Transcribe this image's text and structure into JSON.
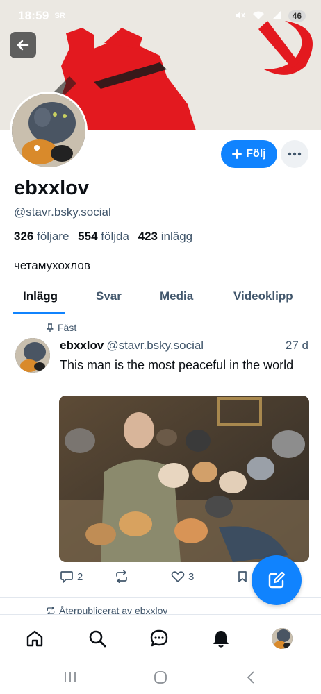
{
  "status_bar": {
    "time": "18:59",
    "notification_icon": "SR",
    "battery": "46",
    "icons": [
      "mute-icon",
      "wifi-icon",
      "signal-icon"
    ]
  },
  "header": {
    "back_icon": "arrow-left-icon"
  },
  "profile": {
    "display_name": "ebxxlov",
    "handle": "@stavr.bsky.social",
    "follow_label": "Följ",
    "more_icon": "ellipsis-icon",
    "stats": {
      "followers_count": "326",
      "followers_label": "följare",
      "following_count": "554",
      "following_label": "följda",
      "posts_count": "423",
      "posts_label": "inlägg"
    },
    "bio": "четамухохлов"
  },
  "tabs": [
    {
      "label": "Inlägg",
      "active": true
    },
    {
      "label": "Svar",
      "active": false
    },
    {
      "label": "Media",
      "active": false
    },
    {
      "label": "Videoklipp",
      "active": false
    }
  ],
  "post": {
    "pinned_label": "Fäst",
    "author": "ebxxlov",
    "handle": "@stavr.bsky.social",
    "time": "27 d",
    "text": "This man is the most peaceful in the world",
    "replies": "2",
    "likes": "3"
  },
  "next_post": {
    "repost_label": "Återpublicerat av ebxxlov"
  },
  "colors": {
    "accent": "#1083fe",
    "text_primary": "#0b0f14",
    "text_secondary": "#42576c",
    "banner_red": "#e3191f"
  }
}
